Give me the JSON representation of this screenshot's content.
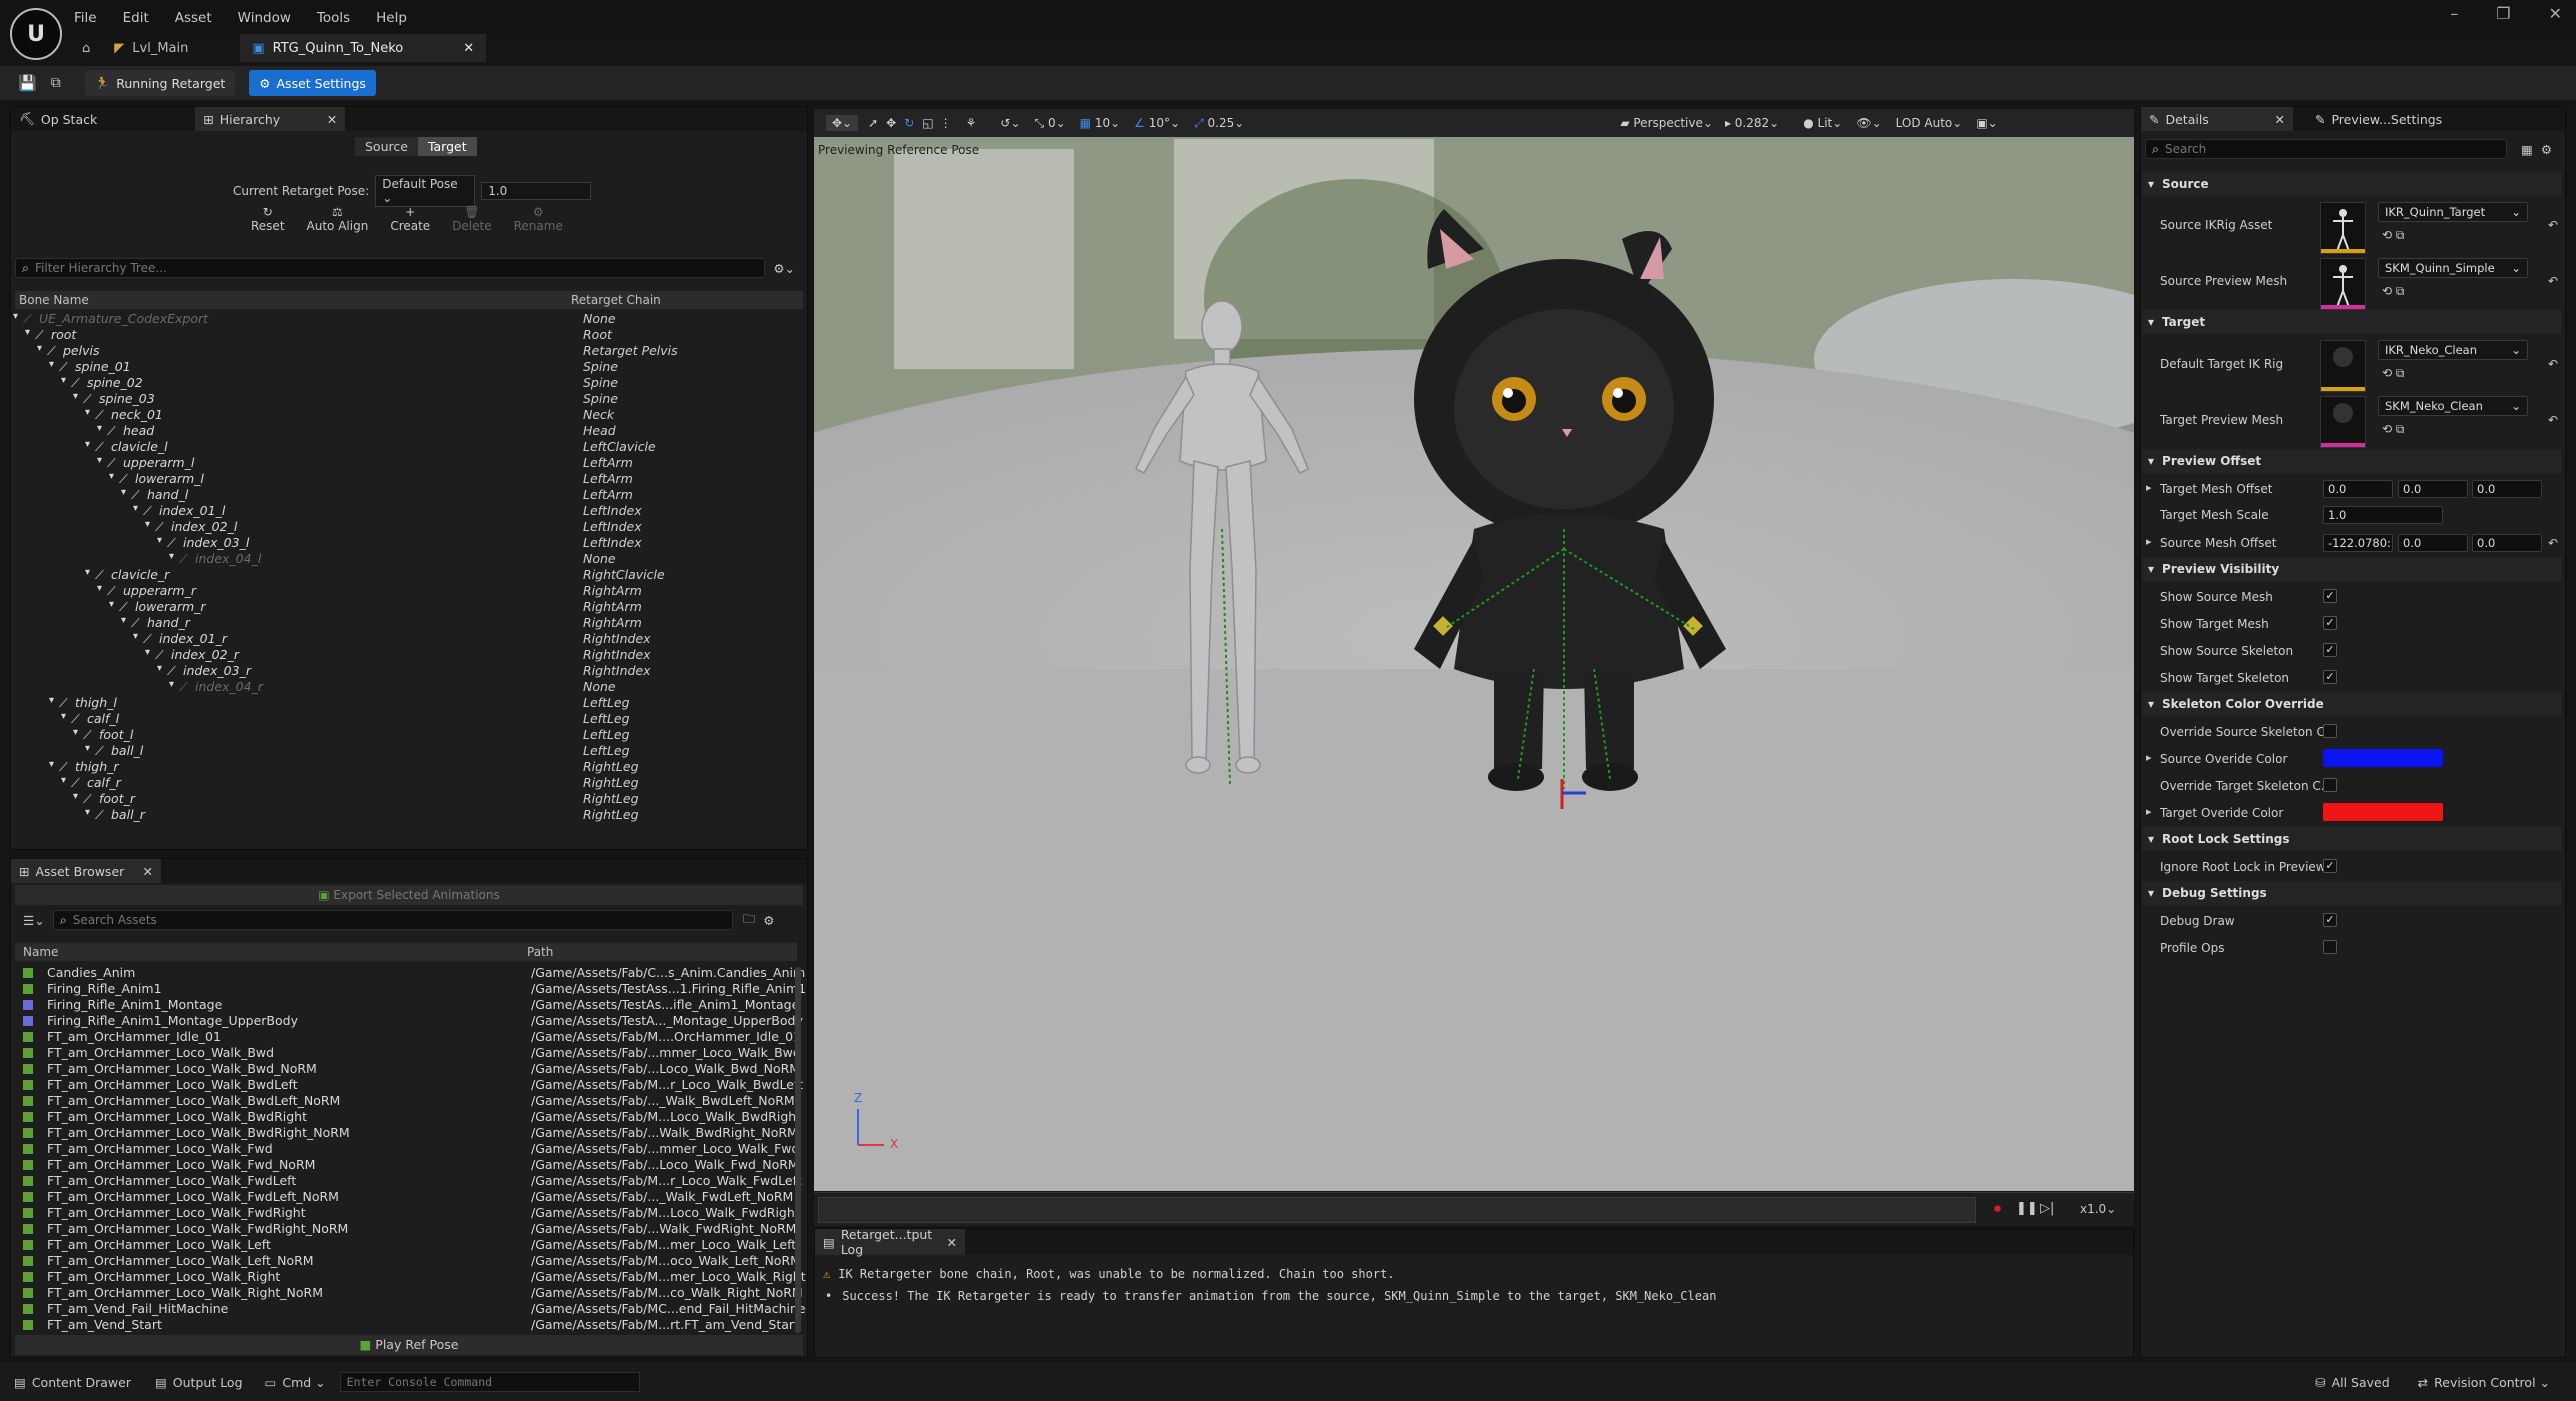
{
  "menu": [
    "File",
    "Edit",
    "Asset",
    "Window",
    "Tools",
    "Help"
  ],
  "logo": "U",
  "window_controls": [
    "–",
    "❐",
    "✕"
  ],
  "tabs": [
    {
      "label": "Lvl_Main"
    },
    {
      "label": "RTG_Quinn_To_Neko"
    }
  ],
  "toolbar": {
    "running": "Running Retarget",
    "asset_settings": "Asset Settings"
  },
  "left_panel": {
    "tabs": [
      "Op Stack",
      "Hierarchy"
    ],
    "source_btn": "Source",
    "target_btn": "Target",
    "pose_label": "Current Retarget Pose:",
    "pose_value": "Default Pose",
    "pose_blend": "1.0",
    "actions": [
      "Reset",
      "Auto Align",
      "Create",
      "Delete",
      "Rename"
    ],
    "filter_placeholder": "Filter Hierarchy Tree...",
    "col_bone": "Bone Name",
    "col_chain": "Retarget Chain",
    "bones": [
      {
        "name": "UE_Armature_CodexExport",
        "chain": "None",
        "depth": 0,
        "dim": true
      },
      {
        "name": "root",
        "chain": "Root",
        "depth": 1
      },
      {
        "name": "pelvis",
        "chain": "Retarget Pelvis",
        "depth": 2
      },
      {
        "name": "spine_01",
        "chain": "Spine",
        "depth": 3
      },
      {
        "name": "spine_02",
        "chain": "Spine",
        "depth": 4
      },
      {
        "name": "spine_03",
        "chain": "Spine",
        "depth": 5
      },
      {
        "name": "neck_01",
        "chain": "Neck",
        "depth": 6
      },
      {
        "name": "head",
        "chain": "Head",
        "depth": 7
      },
      {
        "name": "clavicle_l",
        "chain": "LeftClavicle",
        "depth": 6
      },
      {
        "name": "upperarm_l",
        "chain": "LeftArm",
        "depth": 7
      },
      {
        "name": "lowerarm_l",
        "chain": "LeftArm",
        "depth": 8
      },
      {
        "name": "hand_l",
        "chain": "LeftArm",
        "depth": 9
      },
      {
        "name": "index_01_l",
        "chain": "LeftIndex",
        "depth": 10
      },
      {
        "name": "index_02_l",
        "chain": "LeftIndex",
        "depth": 11
      },
      {
        "name": "index_03_l",
        "chain": "LeftIndex",
        "depth": 12
      },
      {
        "name": "index_04_l",
        "chain": "None",
        "depth": 13,
        "dim": true
      },
      {
        "name": "clavicle_r",
        "chain": "RightClavicle",
        "depth": 6
      },
      {
        "name": "upperarm_r",
        "chain": "RightArm",
        "depth": 7
      },
      {
        "name": "lowerarm_r",
        "chain": "RightArm",
        "depth": 8
      },
      {
        "name": "hand_r",
        "chain": "RightArm",
        "depth": 9
      },
      {
        "name": "index_01_r",
        "chain": "RightIndex",
        "depth": 10
      },
      {
        "name": "index_02_r",
        "chain": "RightIndex",
        "depth": 11
      },
      {
        "name": "index_03_r",
        "chain": "RightIndex",
        "depth": 12
      },
      {
        "name": "index_04_r",
        "chain": "None",
        "depth": 13,
        "dim": true
      },
      {
        "name": "thigh_l",
        "chain": "LeftLeg",
        "depth": 3
      },
      {
        "name": "calf_l",
        "chain": "LeftLeg",
        "depth": 4
      },
      {
        "name": "foot_l",
        "chain": "LeftLeg",
        "depth": 5
      },
      {
        "name": "ball_l",
        "chain": "LeftLeg",
        "depth": 6
      },
      {
        "name": "thigh_r",
        "chain": "RightLeg",
        "depth": 3
      },
      {
        "name": "calf_r",
        "chain": "RightLeg",
        "depth": 4
      },
      {
        "name": "foot_r",
        "chain": "RightLeg",
        "depth": 5
      },
      {
        "name": "ball_r",
        "chain": "RightLeg",
        "depth": 6
      }
    ]
  },
  "asset_browser": {
    "tab": "Asset Browser",
    "export_btn": "Export Selected Animations",
    "search_placeholder": "Search Assets",
    "col_name": "Name",
    "col_path": "Path",
    "play_ref": "Play Ref Pose",
    "assets": [
      {
        "name": "Candies_Anim",
        "path": "/Game/Assets/Fab/C...s_Anim.Candies_Anim"
      },
      {
        "name": "Firing_Rifle_Anim1",
        "path": "/Game/Assets/TestAss...1.Firing_Rifle_Anim1"
      },
      {
        "name": "Firing_Rifle_Anim1_Montage",
        "path": "/Game/Assets/TestAs...ifle_Anim1_Montage",
        "montage": true
      },
      {
        "name": "Firing_Rifle_Anim1_Montage_UpperBody",
        "path": "/Game/Assets/TestA..._Montage_UpperBody",
        "montage": true
      },
      {
        "name": "FT_am_OrcHammer_Idle_01",
        "path": "/Game/Assets/Fab/M....OrcHammer_Idle_01"
      },
      {
        "name": "FT_am_OrcHammer_Loco_Walk_Bwd",
        "path": "/Game/Assets/Fab/...mmer_Loco_Walk_Bwd"
      },
      {
        "name": "FT_am_OrcHammer_Loco_Walk_Bwd_NoRM",
        "path": "/Game/Assets/Fab/...Loco_Walk_Bwd_NoRM"
      },
      {
        "name": "FT_am_OrcHammer_Loco_Walk_BwdLeft",
        "path": "/Game/Assets/Fab/M...r_Loco_Walk_BwdLeft"
      },
      {
        "name": "FT_am_OrcHammer_Loco_Walk_BwdLeft_NoRM",
        "path": "/Game/Assets/Fab/..._Walk_BwdLeft_NoRM"
      },
      {
        "name": "FT_am_OrcHammer_Loco_Walk_BwdRight",
        "path": "/Game/Assets/Fab/M...Loco_Walk_BwdRight"
      },
      {
        "name": "FT_am_OrcHammer_Loco_Walk_BwdRight_NoRM",
        "path": "/Game/Assets/Fab/...Walk_BwdRight_NoRM"
      },
      {
        "name": "FT_am_OrcHammer_Loco_Walk_Fwd",
        "path": "/Game/Assets/Fab/...mmer_Loco_Walk_Fwd"
      },
      {
        "name": "FT_am_OrcHammer_Loco_Walk_Fwd_NoRM",
        "path": "/Game/Assets/Fab/...Loco_Walk_Fwd_NoRM"
      },
      {
        "name": "FT_am_OrcHammer_Loco_Walk_FwdLeft",
        "path": "/Game/Assets/Fab/M...r_Loco_Walk_FwdLeft"
      },
      {
        "name": "FT_am_OrcHammer_Loco_Walk_FwdLeft_NoRM",
        "path": "/Game/Assets/Fab/..._Walk_FwdLeft_NoRM"
      },
      {
        "name": "FT_am_OrcHammer_Loco_Walk_FwdRight",
        "path": "/Game/Assets/Fab/M...Loco_Walk_FwdRight"
      },
      {
        "name": "FT_am_OrcHammer_Loco_Walk_FwdRight_NoRM",
        "path": "/Game/Assets/Fab/...Walk_FwdRight_NoRM"
      },
      {
        "name": "FT_am_OrcHammer_Loco_Walk_Left",
        "path": "/Game/Assets/Fab/M...mer_Loco_Walk_Left"
      },
      {
        "name": "FT_am_OrcHammer_Loco_Walk_Left_NoRM",
        "path": "/Game/Assets/Fab/M...oco_Walk_Left_NoRM"
      },
      {
        "name": "FT_am_OrcHammer_Loco_Walk_Right",
        "path": "/Game/Assets/Fab/M...mer_Loco_Walk_Right"
      },
      {
        "name": "FT_am_OrcHammer_Loco_Walk_Right_NoRM",
        "path": "/Game/Assets/Fab/M...co_Walk_Right_NoRM"
      },
      {
        "name": "FT_am_Vend_Fail_HitMachine",
        "path": "/Game/Assets/Fab/MC...end_Fail_HitMachine"
      },
      {
        "name": "FT_am_Vend_Start",
        "path": "/Game/Assets/Fab/M...rt.FT_am_Vend_Start"
      }
    ]
  },
  "viewport": {
    "mode": "Perspective",
    "fov": "0.282",
    "lit": "Lit",
    "lod": "LOD Auto",
    "snap_move": "0",
    "snap_grid": "10",
    "snap_rot": "10°",
    "snap_scale": "0.25",
    "label": "Previewing Reference Pose",
    "speed": "x1.0",
    "axis_z": "Z",
    "axis_x": "X"
  },
  "output_log": {
    "tab": "Retarget...tput Log",
    "lines": [
      {
        "icon": "⚠",
        "text": "IK Retargeter bone chain, Root, was unable to be normalized. Chain too short."
      },
      {
        "icon": "•",
        "text": "Success! The IK Retargeter is ready to transfer animation from the source, SKM_Quinn_Simple to the target, SKM_Neko_Clean"
      }
    ]
  },
  "details": {
    "tabs": [
      "Details",
      "Preview...Settings"
    ],
    "search_placeholder": "Search",
    "sections": {
      "source": "Source",
      "target": "Target",
      "preview_offset": "Preview Offset",
      "preview_visibility": "Preview Visibility",
      "skeleton_color": "Skeleton Color Override",
      "root_lock": "Root Lock Settings",
      "debug": "Debug Settings"
    },
    "source_ik_label": "Source IKRig Asset",
    "source_ik_value": "IKR_Quinn_Target",
    "source_mesh_label": "Source Preview Mesh",
    "source_mesh_value": "SKM_Quinn_Simple",
    "target_ik_label": "Default Target IK Rig",
    "target_ik_value": "IKR_Neko_Clean",
    "target_mesh_label": "Target Preview Mesh",
    "target_mesh_value": "SKM_Neko_Clean",
    "target_offset_label": "Target Mesh Offset",
    "target_offset": [
      "0.0",
      "0.0",
      "0.0"
    ],
    "target_scale_label": "Target Mesh Scale",
    "target_scale": "1.0",
    "source_offset_label": "Source Mesh Offset",
    "source_offset": [
      "-122.0780:",
      "0.0",
      "0.0"
    ],
    "show_source_mesh": "Show Source Mesh",
    "show_target_mesh": "Show Target Mesh",
    "show_source_skel": "Show Source Skeleton",
    "show_target_skel": "Show Target Skeleton",
    "override_source": "Override Source Skeleton C...",
    "source_color_label": "Source Overide Color",
    "override_target": "Override Target Skeleton C...",
    "target_color_label": "Target Overide Color",
    "ignore_root": "Ignore Root Lock in Preview",
    "debug_draw": "Debug Draw",
    "profile_ops": "Profile Ops",
    "source_color": "#0a14f0",
    "target_color": "#f01414"
  },
  "statusbar": {
    "content_drawer": "Content Drawer",
    "output_log": "Output Log",
    "cmd": "Cmd",
    "console_placeholder": "Enter Console Command",
    "all_saved": "All Saved",
    "revision": "Revision Control"
  }
}
